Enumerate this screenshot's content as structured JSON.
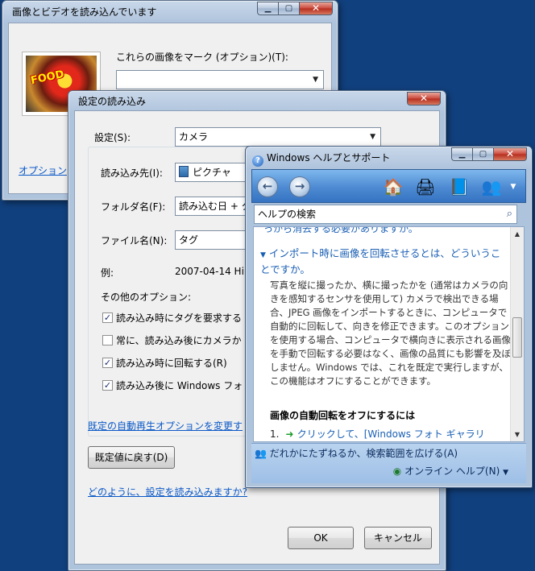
{
  "win1": {
    "title": "画像とビデオを読み込んでいます",
    "tag_prompt": "これらの画像をマーク (オプション)(T):",
    "tag_value": "",
    "options_link": "オプション"
  },
  "win2": {
    "title": "設定の読み込み",
    "settings_label": "設定(S):",
    "settings_value": "カメラ",
    "dest_label": "読み込み先(I):",
    "dest_value": "ピクチャ",
    "folder_label": "フォルダ名(F):",
    "folder_value": "読み込む日 + タ",
    "file_label": "ファイル名(N):",
    "file_value": "タグ",
    "example_label": "例:",
    "example_value": "2007-04-14 Hir",
    "other_options": "その他のオプション:",
    "checkboxes": [
      {
        "label": "読み込み時にタグを要求する",
        "checked": true
      },
      {
        "label": "常に、読み込み後にカメラか",
        "checked": false
      },
      {
        "label": "読み込み時に回転する(R)",
        "checked": true
      },
      {
        "label": "読み込み後に Windows フォ",
        "checked": true
      }
    ],
    "autoplay_link": "既定の自動再生オプションを変更す",
    "reset_button": "既定値に戻す(D)",
    "howto_link": "どのように、設定を読み込みますか?",
    "ok_button": "OK",
    "cancel_button": "キャンセル"
  },
  "win3": {
    "title": "Windows ヘルプとサポート",
    "search_placeholder": "ヘルプの検索",
    "cut_text": "っから消去する必要がありますか。",
    "question": "インポート時に画像を回転させるとは、どういうことですか。",
    "paragraph": "写真を縦に撮ったか、横に撮ったかを (通常はカメラの向きを感知するセンサを使用して) カメラで検出できる場合、JPEG 画像をインポートするときに、コンピュータで自動的に回転して、向きを修正できます。このオプションを使用する場合、コンピュータで横向きに表示される画像を手動で回転する必要はなく、画像の品質にも影響を及ぼしません。Windows では、これを既定で実行しますが、この機能はオフにすることができます。",
    "heading": "画像の自動回転をオフにするには",
    "step_number": "1.",
    "step_text": "クリックして、[Windows フォト ギャラリ",
    "ask_link": "だれかにたずねるか、検索範囲を広げる(A)",
    "online_help": "オンライン ヘルプ(N)"
  }
}
